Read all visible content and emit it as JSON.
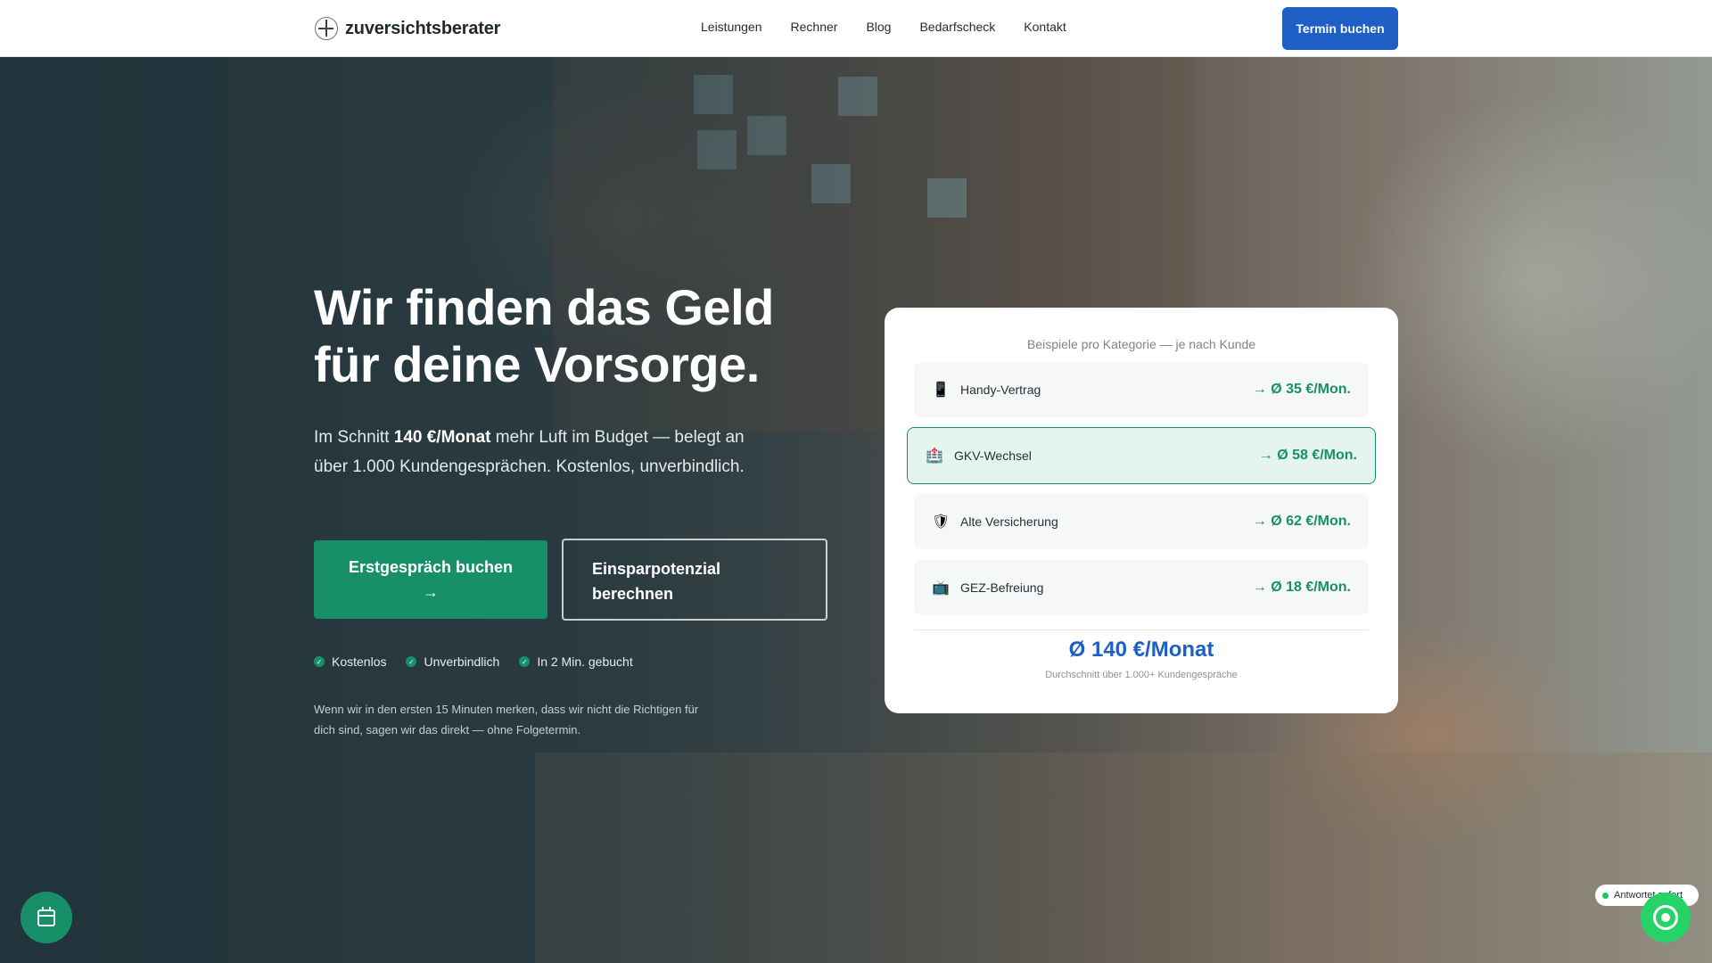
{
  "header": {
    "logo_text": "zuversichtsberater",
    "nav": [
      "Leistungen",
      "Rechner",
      "Blog",
      "Bedarfscheck",
      "Kontakt"
    ],
    "cta": "Termin buchen"
  },
  "hero": {
    "headline_line1": "Wir finden das Geld",
    "headline_line2": "für deine Vorsorge.",
    "subtitle_pre": "Im Schnitt ",
    "subtitle_bold": "140 €/Monat",
    "subtitle_post": " mehr Luft im Budget — belegt an über 1.000 Kundengesprächen. Kostenlos, unverbindlich.",
    "primary_button_label": "Erstgespräch buchen",
    "primary_button_arrow": "→",
    "secondary_button_line1": "Einsparpotenzial",
    "secondary_button_line2": "berechnen",
    "checks": [
      "Kostenlos",
      "Unverbindlich",
      "In 2 Min. gebucht"
    ],
    "check_glyph": "✓",
    "note": "Wenn wir in den ersten 15 Minuten merken, dass wir nicht die Richtigen für dich sind, sagen wir das direkt — ohne Folgetermin."
  },
  "savings_card": {
    "caption": "Beispiele pro Kategorie — je nach Kunde",
    "rows": [
      {
        "icon": "mobile-phone-icon",
        "glyph": "📱",
        "label": "Handy-Vertrag",
        "value": "→ Ø 35 €/Mon."
      },
      {
        "icon": "hospital-icon",
        "glyph": "🏥",
        "label": "GKV-Wechsel",
        "value": "→ Ø 58 €/Mon.",
        "highlighted": true
      },
      {
        "icon": "shield-icon",
        "glyph": "🛡",
        "label": "Alte Versicherung",
        "value": "→ Ø 62 €/Mon."
      },
      {
        "icon": "tv-icon",
        "glyph": "📺",
        "label": "GEZ-Befreiung",
        "value": "→ Ø 18 €/Mon."
      }
    ],
    "total": "Ø 140 €/Monat",
    "total_caption": "Durchschnitt über 1.000+ Kundengespräche"
  },
  "floating": {
    "status": "Antwortet sofort",
    "calendar_icon": "calendar-icon",
    "whatsapp_icon": "whatsapp-icon"
  },
  "colors": {
    "brand_blue": "#1d5fc4",
    "brand_green": "#17906a",
    "whatsapp_green": "#25d366"
  }
}
